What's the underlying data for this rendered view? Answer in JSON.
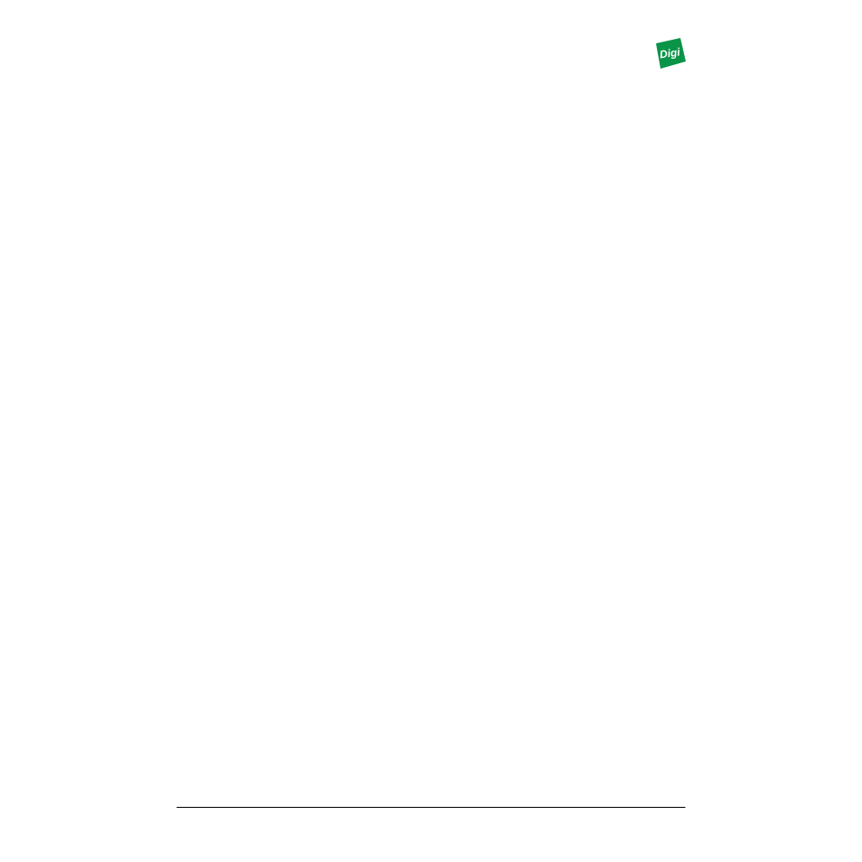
{
  "logo": {
    "name": "digi-logo",
    "text": "Digi"
  }
}
